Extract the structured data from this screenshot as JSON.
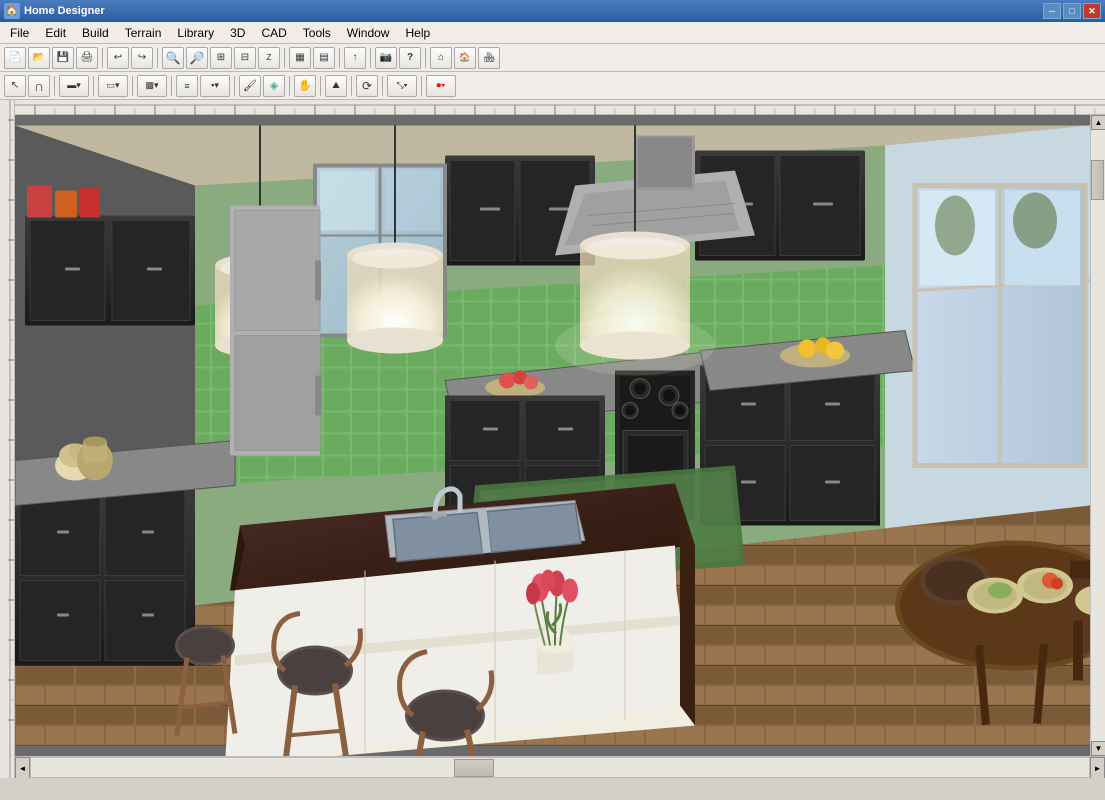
{
  "window": {
    "title": "Home Designer",
    "icon": "🏠"
  },
  "titlebar": {
    "controls": {
      "minimize": "─",
      "maximize": "□",
      "close": "✕"
    }
  },
  "menubar": {
    "items": [
      {
        "label": "File",
        "id": "file"
      },
      {
        "label": "Edit",
        "id": "edit"
      },
      {
        "label": "Build",
        "id": "build"
      },
      {
        "label": "Terrain",
        "id": "terrain"
      },
      {
        "label": "Library",
        "id": "library"
      },
      {
        "label": "3D",
        "id": "3d"
      },
      {
        "label": "CAD",
        "id": "cad"
      },
      {
        "label": "Tools",
        "id": "tools"
      },
      {
        "label": "Window",
        "id": "window"
      },
      {
        "label": "Help",
        "id": "help"
      }
    ]
  },
  "toolbar1": {
    "tools": [
      {
        "id": "new",
        "icon": "📄",
        "tip": "New"
      },
      {
        "id": "open",
        "icon": "📂",
        "tip": "Open"
      },
      {
        "id": "save",
        "icon": "💾",
        "tip": "Save"
      },
      {
        "id": "print",
        "icon": "🖨",
        "tip": "Print"
      },
      {
        "id": "sep1",
        "type": "sep"
      },
      {
        "id": "undo",
        "icon": "↩",
        "tip": "Undo"
      },
      {
        "id": "redo",
        "icon": "↪",
        "tip": "Redo"
      },
      {
        "id": "sep2",
        "type": "sep"
      },
      {
        "id": "zoom-in",
        "icon": "🔍",
        "tip": "Zoom In"
      },
      {
        "id": "zoom-out",
        "icon": "🔎",
        "tip": "Zoom Out"
      },
      {
        "id": "zoom-fit",
        "icon": "⊞",
        "tip": "Zoom Fit"
      },
      {
        "id": "zoom-extents",
        "icon": "⊟",
        "tip": "Zoom Extents"
      },
      {
        "id": "sep3",
        "type": "sep"
      },
      {
        "id": "fill",
        "icon": "▦",
        "tip": "Fill"
      },
      {
        "id": "sep4",
        "type": "sep"
      },
      {
        "id": "arrow-up",
        "icon": "↑",
        "tip": "Arrow"
      },
      {
        "id": "sep5",
        "type": "sep"
      },
      {
        "id": "toolbar5",
        "icon": "⛏",
        "tip": "Tool5"
      },
      {
        "id": "help",
        "icon": "?",
        "tip": "Help"
      },
      {
        "id": "sep6",
        "type": "sep"
      },
      {
        "id": "house",
        "icon": "🏠",
        "tip": "House View"
      },
      {
        "id": "house2",
        "icon": "🏡",
        "tip": "3D View"
      },
      {
        "id": "roof",
        "icon": "🏘",
        "tip": "Roof"
      }
    ]
  },
  "toolbar2": {
    "tools": [
      {
        "id": "select",
        "icon": "↖",
        "tip": "Select"
      },
      {
        "id": "arc",
        "icon": "∩",
        "tip": "Arc"
      },
      {
        "id": "sep1",
        "type": "sep"
      },
      {
        "id": "wall",
        "icon": "▬",
        "tip": "Wall"
      },
      {
        "id": "sep2",
        "type": "sep"
      },
      {
        "id": "door",
        "icon": "▭",
        "tip": "Door"
      },
      {
        "id": "sep3",
        "type": "sep"
      },
      {
        "id": "window",
        "icon": "▩",
        "tip": "Window"
      },
      {
        "id": "sep4",
        "type": "sep"
      },
      {
        "id": "copy",
        "icon": "⧉",
        "tip": "Copy"
      },
      {
        "id": "paste",
        "icon": "📋",
        "tip": "Paste"
      },
      {
        "id": "sep5",
        "type": "sep"
      },
      {
        "id": "paint",
        "icon": "🖌",
        "tip": "Paint"
      },
      {
        "id": "gradient",
        "icon": "▤",
        "tip": "Gradient"
      },
      {
        "id": "sep6",
        "type": "sep"
      },
      {
        "id": "hand",
        "icon": "✋",
        "tip": "Hand"
      },
      {
        "id": "sep7",
        "type": "sep"
      },
      {
        "id": "measure",
        "icon": "📐",
        "tip": "Measure"
      },
      {
        "id": "sep8",
        "type": "sep"
      },
      {
        "id": "rotate",
        "icon": "⟳",
        "tip": "Rotate"
      },
      {
        "id": "sep9",
        "type": "sep"
      },
      {
        "id": "transform",
        "icon": "⤡",
        "tip": "Transform"
      },
      {
        "id": "sep10",
        "type": "sep"
      },
      {
        "id": "record",
        "icon": "⏺",
        "tip": "Record"
      }
    ]
  },
  "scene": {
    "description": "3D Kitchen render showing dark cabinets, green tile backsplash, island with sink, bar stools, pendant lights"
  },
  "scrollbars": {
    "up": "▲",
    "down": "▼",
    "left": "◄",
    "right": "►"
  }
}
